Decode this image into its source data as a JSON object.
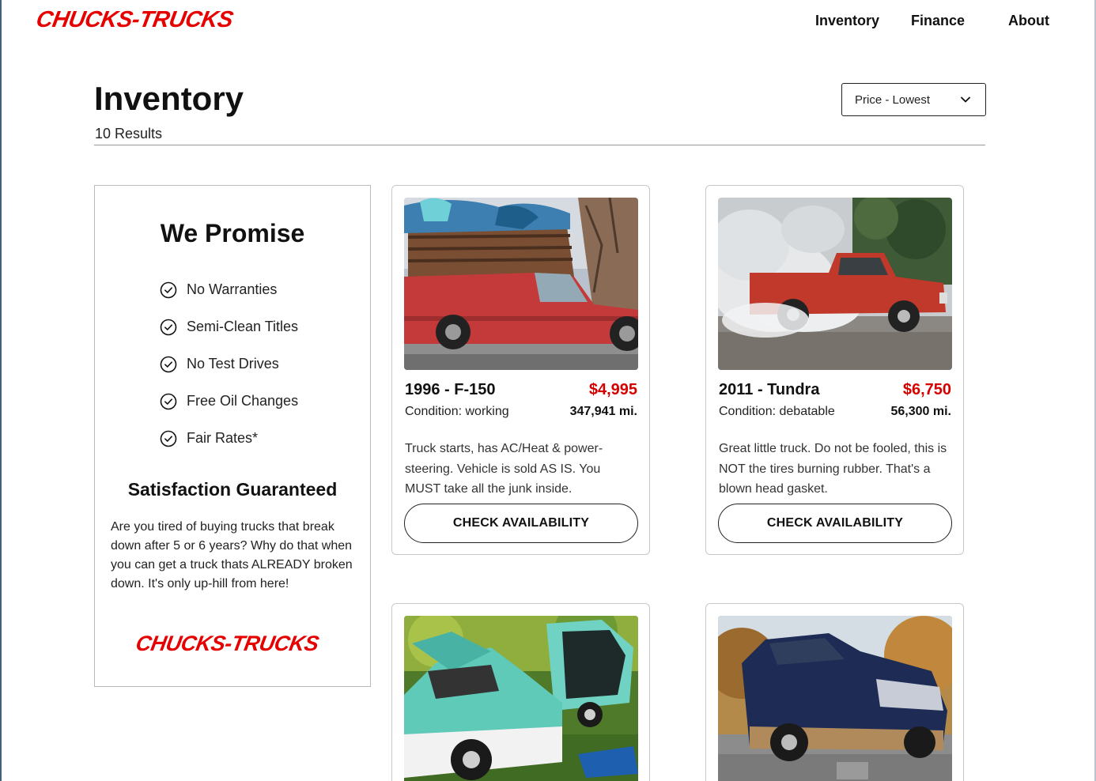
{
  "brand": {
    "logo_text": "CHUCKS-TRUCKS",
    "color": "#e60000"
  },
  "nav": {
    "items": [
      "Inventory",
      "Finance",
      "About"
    ]
  },
  "page": {
    "title": "Inventory",
    "results": "10 Results"
  },
  "sort": {
    "selected": "Price - Lowest",
    "icon": "chevron-down-icon"
  },
  "promise": {
    "title": "We Promise",
    "items": [
      "No Warranties",
      "Semi-Clean Titles",
      "No Test Drives",
      "Free Oil Changes",
      "Fair Rates*"
    ],
    "item_icon": "check-circle-icon",
    "satisfaction_title": "Satisfaction Guaranteed",
    "satisfaction_text": "Are you tired of buying trucks that break down after 5 or 6 years? Why do that when you can get a truck thats ALREADY broken down. It's only up-hill from here!",
    "logo_text": "CHUCKS-TRUCKS"
  },
  "listings": [
    {
      "name": "1996 - F-150",
      "price": "$4,995",
      "condition": "Condition: working",
      "miles": "347,941 mi.",
      "description": "Truck starts, has AC/Heat & power-steering. Vehicle is sold AS IS. You MUST take all the junk inside.",
      "cta": "CHECK AVAILABILITY",
      "photo": "red truck loaded with junk"
    },
    {
      "name": "2011 - Tundra",
      "price": "$6,750",
      "condition": "Condition: debatable",
      "miles": "56,300 mi.",
      "description": "Great little truck. Do not be fooled, this is NOT the tires burning rubber. That's a blown head gasket.",
      "cta": "CHECK AVAILABILITY",
      "photo": "red pickup in smoke"
    },
    {
      "photo": "teal and white truck with open hood"
    },
    {
      "photo": "blue pickup missing wheel"
    }
  ],
  "colors": {
    "price": "#d40000",
    "accent": "#e60000"
  }
}
